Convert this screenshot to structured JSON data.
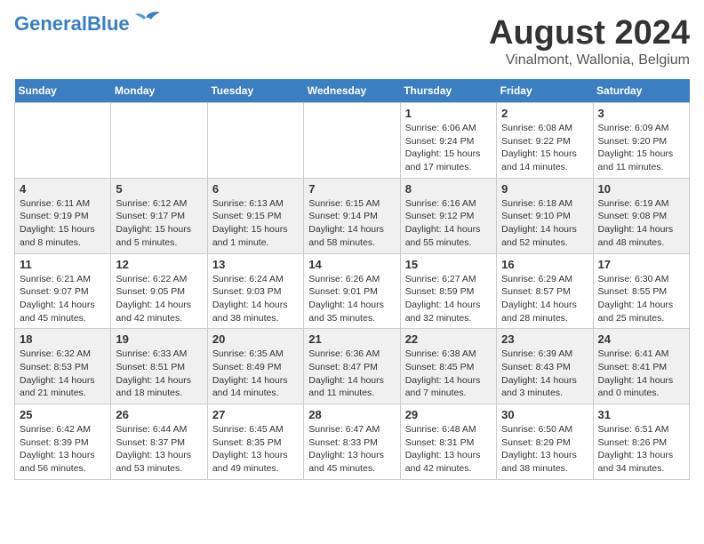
{
  "header": {
    "logo_general": "General",
    "logo_blue": "Blue",
    "main_title": "August 2024",
    "subtitle": "Vinalmont, Wallonia, Belgium"
  },
  "days_of_week": [
    "Sunday",
    "Monday",
    "Tuesday",
    "Wednesday",
    "Thursday",
    "Friday",
    "Saturday"
  ],
  "weeks": [
    [
      {
        "day": "",
        "info": ""
      },
      {
        "day": "",
        "info": ""
      },
      {
        "day": "",
        "info": ""
      },
      {
        "day": "",
        "info": ""
      },
      {
        "day": "1",
        "info": "Sunrise: 6:06 AM\nSunset: 9:24 PM\nDaylight: 15 hours\nand 17 minutes."
      },
      {
        "day": "2",
        "info": "Sunrise: 6:08 AM\nSunset: 9:22 PM\nDaylight: 15 hours\nand 14 minutes."
      },
      {
        "day": "3",
        "info": "Sunrise: 6:09 AM\nSunset: 9:20 PM\nDaylight: 15 hours\nand 11 minutes."
      }
    ],
    [
      {
        "day": "4",
        "info": "Sunrise: 6:11 AM\nSunset: 9:19 PM\nDaylight: 15 hours\nand 8 minutes."
      },
      {
        "day": "5",
        "info": "Sunrise: 6:12 AM\nSunset: 9:17 PM\nDaylight: 15 hours\nand 5 minutes."
      },
      {
        "day": "6",
        "info": "Sunrise: 6:13 AM\nSunset: 9:15 PM\nDaylight: 15 hours\nand 1 minute."
      },
      {
        "day": "7",
        "info": "Sunrise: 6:15 AM\nSunset: 9:14 PM\nDaylight: 14 hours\nand 58 minutes."
      },
      {
        "day": "8",
        "info": "Sunrise: 6:16 AM\nSunset: 9:12 PM\nDaylight: 14 hours\nand 55 minutes."
      },
      {
        "day": "9",
        "info": "Sunrise: 6:18 AM\nSunset: 9:10 PM\nDaylight: 14 hours\nand 52 minutes."
      },
      {
        "day": "10",
        "info": "Sunrise: 6:19 AM\nSunset: 9:08 PM\nDaylight: 14 hours\nand 48 minutes."
      }
    ],
    [
      {
        "day": "11",
        "info": "Sunrise: 6:21 AM\nSunset: 9:07 PM\nDaylight: 14 hours\nand 45 minutes."
      },
      {
        "day": "12",
        "info": "Sunrise: 6:22 AM\nSunset: 9:05 PM\nDaylight: 14 hours\nand 42 minutes."
      },
      {
        "day": "13",
        "info": "Sunrise: 6:24 AM\nSunset: 9:03 PM\nDaylight: 14 hours\nand 38 minutes."
      },
      {
        "day": "14",
        "info": "Sunrise: 6:26 AM\nSunset: 9:01 PM\nDaylight: 14 hours\nand 35 minutes."
      },
      {
        "day": "15",
        "info": "Sunrise: 6:27 AM\nSunset: 8:59 PM\nDaylight: 14 hours\nand 32 minutes."
      },
      {
        "day": "16",
        "info": "Sunrise: 6:29 AM\nSunset: 8:57 PM\nDaylight: 14 hours\nand 28 minutes."
      },
      {
        "day": "17",
        "info": "Sunrise: 6:30 AM\nSunset: 8:55 PM\nDaylight: 14 hours\nand 25 minutes."
      }
    ],
    [
      {
        "day": "18",
        "info": "Sunrise: 6:32 AM\nSunset: 8:53 PM\nDaylight: 14 hours\nand 21 minutes."
      },
      {
        "day": "19",
        "info": "Sunrise: 6:33 AM\nSunset: 8:51 PM\nDaylight: 14 hours\nand 18 minutes."
      },
      {
        "day": "20",
        "info": "Sunrise: 6:35 AM\nSunset: 8:49 PM\nDaylight: 14 hours\nand 14 minutes."
      },
      {
        "day": "21",
        "info": "Sunrise: 6:36 AM\nSunset: 8:47 PM\nDaylight: 14 hours\nand 11 minutes."
      },
      {
        "day": "22",
        "info": "Sunrise: 6:38 AM\nSunset: 8:45 PM\nDaylight: 14 hours\nand 7 minutes."
      },
      {
        "day": "23",
        "info": "Sunrise: 6:39 AM\nSunset: 8:43 PM\nDaylight: 14 hours\nand 3 minutes."
      },
      {
        "day": "24",
        "info": "Sunrise: 6:41 AM\nSunset: 8:41 PM\nDaylight: 14 hours\nand 0 minutes."
      }
    ],
    [
      {
        "day": "25",
        "info": "Sunrise: 6:42 AM\nSunset: 8:39 PM\nDaylight: 13 hours\nand 56 minutes."
      },
      {
        "day": "26",
        "info": "Sunrise: 6:44 AM\nSunset: 8:37 PM\nDaylight: 13 hours\nand 53 minutes."
      },
      {
        "day": "27",
        "info": "Sunrise: 6:45 AM\nSunset: 8:35 PM\nDaylight: 13 hours\nand 49 minutes."
      },
      {
        "day": "28",
        "info": "Sunrise: 6:47 AM\nSunset: 8:33 PM\nDaylight: 13 hours\nand 45 minutes."
      },
      {
        "day": "29",
        "info": "Sunrise: 6:48 AM\nSunset: 8:31 PM\nDaylight: 13 hours\nand 42 minutes."
      },
      {
        "day": "30",
        "info": "Sunrise: 6:50 AM\nSunset: 8:29 PM\nDaylight: 13 hours\nand 38 minutes."
      },
      {
        "day": "31",
        "info": "Sunrise: 6:51 AM\nSunset: 8:26 PM\nDaylight: 13 hours\nand 34 minutes."
      }
    ]
  ]
}
